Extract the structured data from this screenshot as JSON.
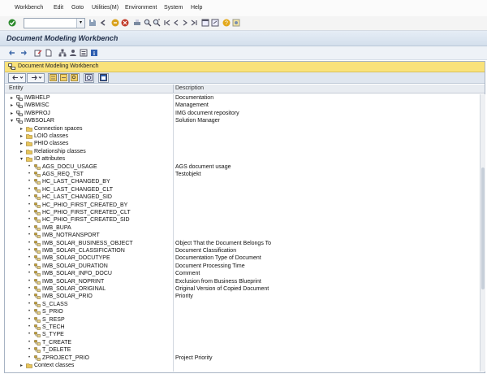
{
  "menubar": {
    "items": [
      {
        "label": "Workbench"
      },
      {
        "label": "Edit"
      },
      {
        "label": "Goto"
      },
      {
        "label": "Utilities(M)"
      },
      {
        "label": "Environment"
      },
      {
        "label": "System"
      },
      {
        "label": "Help"
      }
    ]
  },
  "window": {
    "title": "Document Modeling Workbench"
  },
  "panel": {
    "title": "Document Modeling Workbench"
  },
  "columns": {
    "entity": "Entity",
    "description": "Description"
  },
  "rows": [
    {
      "name": "IWBHELP",
      "desc": "Documentation",
      "level": 0,
      "kind": "node",
      "expanded": false
    },
    {
      "name": "IWBMISC",
      "desc": "Management",
      "level": 0,
      "kind": "node",
      "expanded": false
    },
    {
      "name": "IWBPROJ",
      "desc": "IMG document repository",
      "level": 0,
      "kind": "node",
      "expanded": false
    },
    {
      "name": "IWBSOLAR",
      "desc": "Solution Manager",
      "level": 0,
      "kind": "node",
      "expanded": true
    },
    {
      "name": "Connection spaces",
      "desc": "",
      "level": 1,
      "kind": "folder",
      "expanded": false
    },
    {
      "name": "LOIO classes",
      "desc": "",
      "level": 1,
      "kind": "folder",
      "expanded": false
    },
    {
      "name": "PHIO classes",
      "desc": "",
      "level": 1,
      "kind": "folder",
      "expanded": false
    },
    {
      "name": "Relationship classes",
      "desc": "",
      "level": 1,
      "kind": "folder",
      "expanded": false
    },
    {
      "name": "IO attributes",
      "desc": "",
      "level": 1,
      "kind": "folder",
      "expanded": true
    },
    {
      "name": "AGS_DOCU_USAGE",
      "desc": "AGS document usage",
      "level": 2,
      "kind": "attr"
    },
    {
      "name": "AGS_REQ_TST",
      "desc": "Testobjekt",
      "level": 2,
      "kind": "attr"
    },
    {
      "name": "HC_LAST_CHANGED_BY",
      "desc": "",
      "level": 2,
      "kind": "attr"
    },
    {
      "name": "HC_LAST_CHANGED_CLT",
      "desc": "",
      "level": 2,
      "kind": "attr"
    },
    {
      "name": "HC_LAST_CHANGED_SID",
      "desc": "",
      "level": 2,
      "kind": "attr"
    },
    {
      "name": "HC_PHIO_FIRST_CREATED_BY",
      "desc": "",
      "level": 2,
      "kind": "attr"
    },
    {
      "name": "HC_PHIO_FIRST_CREATED_CLT",
      "desc": "",
      "level": 2,
      "kind": "attr"
    },
    {
      "name": "HC_PHIO_FIRST_CREATED_SID",
      "desc": "",
      "level": 2,
      "kind": "attr"
    },
    {
      "name": "IWB_BUPA",
      "desc": "",
      "level": 2,
      "kind": "attr"
    },
    {
      "name": "IWB_NOTRANSPORT",
      "desc": "",
      "level": 2,
      "kind": "attr"
    },
    {
      "name": "IWB_SOLAR_BUSINESS_OBJECT",
      "desc": "Object That the Document Belongs To",
      "level": 2,
      "kind": "attr"
    },
    {
      "name": "IWB_SOLAR_CLASSIFICATION",
      "desc": "Document Classification",
      "level": 2,
      "kind": "attr"
    },
    {
      "name": "IWB_SOLAR_DOCUTYPE",
      "desc": "Documentation Type of Document",
      "level": 2,
      "kind": "attr"
    },
    {
      "name": "IWB_SOLAR_DURATION",
      "desc": "Document Processing Time",
      "level": 2,
      "kind": "attr"
    },
    {
      "name": "IWB_SOLAR_INFO_DOCU",
      "desc": "Comment",
      "level": 2,
      "kind": "attr"
    },
    {
      "name": "IWB_SOLAR_NOPRINT",
      "desc": "Exclusion from Business Blueprint",
      "level": 2,
      "kind": "attr"
    },
    {
      "name": "IWB_SOLAR_ORIGINAL",
      "desc": "Original Version of Copied Document",
      "level": 2,
      "kind": "attr"
    },
    {
      "name": "IWB_SOLAR_PRIO",
      "desc": "Priority",
      "level": 2,
      "kind": "attr"
    },
    {
      "name": "S_CLASS",
      "desc": "",
      "level": 2,
      "kind": "attr"
    },
    {
      "name": "S_PRIO",
      "desc": "",
      "level": 2,
      "kind": "attr"
    },
    {
      "name": "S_RESP",
      "desc": "",
      "level": 2,
      "kind": "attr"
    },
    {
      "name": "S_TECH",
      "desc": "",
      "level": 2,
      "kind": "attr"
    },
    {
      "name": "S_TYPE",
      "desc": "",
      "level": 2,
      "kind": "attr"
    },
    {
      "name": "T_CREATE",
      "desc": "",
      "level": 2,
      "kind": "attr"
    },
    {
      "name": "T_DELETE",
      "desc": "",
      "level": 2,
      "kind": "attr"
    },
    {
      "name": "ZPROJECT_PRIO",
      "desc": "Project Priority",
      "level": 2,
      "kind": "attr"
    },
    {
      "name": "Context classes",
      "desc": "",
      "level": 1,
      "kind": "folder",
      "expanded": false
    }
  ],
  "colors": {
    "panel_header": "#f9e27a",
    "folder": "#e8c55a",
    "title_text": "#22304a",
    "attr_icon": "#c9a132"
  }
}
